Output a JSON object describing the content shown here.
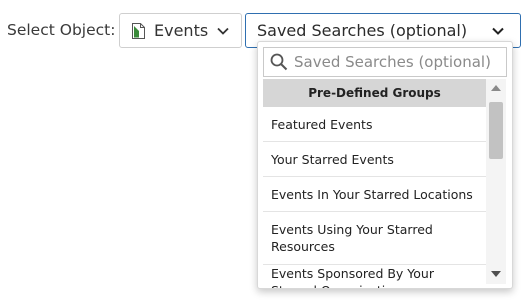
{
  "select_object": {
    "label": "Select Object:",
    "button_label": "Events",
    "button_icon": "document-icon",
    "icon_color": "#3a8a3a"
  },
  "saved_searches": {
    "selected_text": "Saved Searches (optional)",
    "accent_color": "#2f6fb0"
  },
  "dropdown": {
    "search_placeholder": "Saved Searches (optional)",
    "group_header": "Pre-Defined Groups",
    "items": [
      "Featured Events",
      "Your Starred Events",
      "Events In Your Starred Locations",
      "Events Using Your Starred Resources",
      "Events Sponsored By Your Starred Organizations"
    ]
  }
}
